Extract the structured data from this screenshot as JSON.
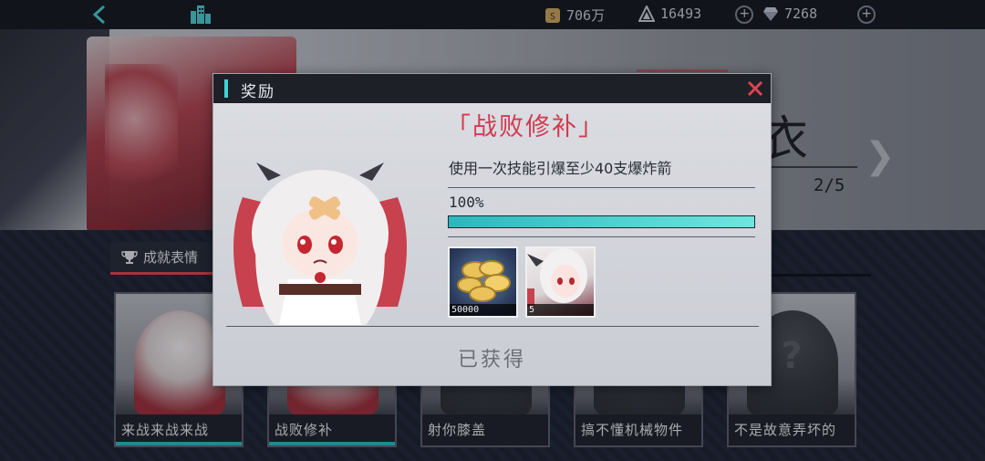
{
  "topbar": {
    "back_icon": "back-arrow-icon",
    "home_icon": "city-icon",
    "resources": [
      {
        "icon": "gold-coin-icon",
        "value": "706万"
      },
      {
        "icon": "stamina-triangle-icon",
        "value": "16493"
      },
      {
        "icon": "diamond-icon",
        "value": "7268"
      }
    ]
  },
  "background": {
    "character_name": "濑田衣",
    "progress_count": "2/5"
  },
  "tab": {
    "label": "成就表情",
    "icon": "trophy-icon"
  },
  "cards": [
    {
      "label": "来战来战来战",
      "state": "done"
    },
    {
      "label": "战败修补",
      "state": "done"
    },
    {
      "label": "射你膝盖",
      "state": "locked"
    },
    {
      "label": "搞不懂机械物件",
      "state": "locked"
    },
    {
      "label": "不是故意弄坏的",
      "state": "locked"
    }
  ],
  "modal": {
    "title": "奖励",
    "close_icon": "close-x-icon",
    "achievement_title": "「战败修补」",
    "description": "使用一次技能引爆至少40支爆炸箭",
    "progress_text": "100%",
    "progress_value": 1.0,
    "rewards": [
      {
        "icon": "gold-coins-icon",
        "amount": "50000"
      },
      {
        "icon": "character-portrait-icon",
        "amount": "5"
      }
    ],
    "status": "已获得"
  },
  "colors": {
    "accent_red": "#d23a50",
    "accent_cyan": "#3ed3d6",
    "progress_fill": "#4fd3d3"
  }
}
